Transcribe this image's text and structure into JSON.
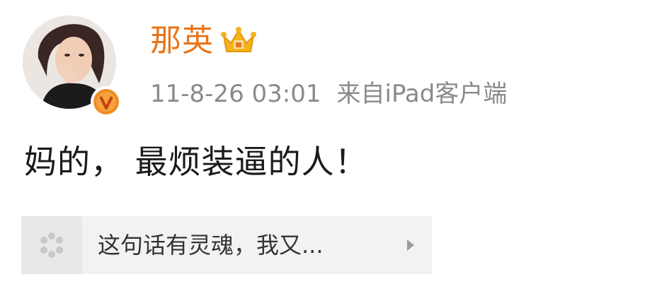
{
  "user": {
    "name": "那英"
  },
  "post": {
    "timestamp": "11-8-26 03:01",
    "source": "来自iPad客户端",
    "content": "妈的， 最烦装逼的人！"
  },
  "repost_card": {
    "text": "这句话有灵魂，我又..."
  },
  "colors": {
    "username": "#e8751a",
    "meta": "#8a8a8a",
    "content": "#1a1a1a",
    "badge_orange": "#f08a24",
    "crown_gold": "#f5b21a",
    "card_bg": "#f2f2f2"
  },
  "icons": {
    "verified": "verified-v-badge-icon",
    "crown": "crown-icon",
    "card": "pinwheel-icon",
    "arrow": "play-arrow-icon"
  }
}
